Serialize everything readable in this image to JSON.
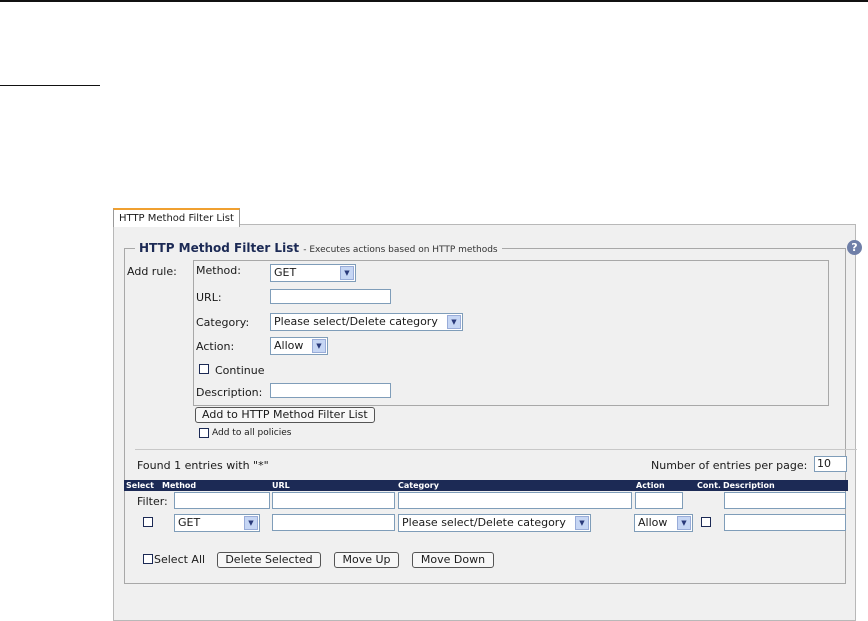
{
  "tab": {
    "label": "HTTP Method Filter List"
  },
  "section": {
    "title": "HTTP Method Filter List",
    "subtitle": "- Executes actions based on HTTP methods",
    "help_glyph": "?"
  },
  "add_rule": {
    "label": "Add rule:",
    "method_label": "Method:",
    "method_value": "GET",
    "url_label": "URL:",
    "url_value": "",
    "category_label": "Category:",
    "category_value": "Please select/Delete category",
    "action_label": "Action:",
    "action_value": "Allow",
    "continue_label": "Continue",
    "continue_checked": false,
    "description_label": "Description:",
    "description_value": "",
    "add_button": "Add to HTTP Method Filter List",
    "all_policies_label": "Add to all policies",
    "all_policies_checked": false
  },
  "list": {
    "found_text": "Found 1 entries with \"*\"",
    "per_page_label": "Number of entries per page:",
    "per_page_value": "10",
    "columns": {
      "select": "Select",
      "method": "Method",
      "url": "URL",
      "category": "Category",
      "action": "Action",
      "cont": "Cont.",
      "description": "Description"
    },
    "filter_label": "Filter:",
    "rows": [
      {
        "method": "GET",
        "url": "",
        "category": "Please select/Delete category",
        "action": "Allow",
        "continue": false,
        "description": ""
      }
    ],
    "select_all_label": "Select All",
    "delete_selected": "Delete Selected",
    "move_up": "Move Up",
    "move_down": "Move Down"
  },
  "colors": {
    "accent_tab": "#f0a030",
    "header_bg": "#1c2a55",
    "panel_bg": "#f0f0f0"
  },
  "icons": {
    "help": "question-circle-icon",
    "dropdown": "chevron-down-icon"
  }
}
